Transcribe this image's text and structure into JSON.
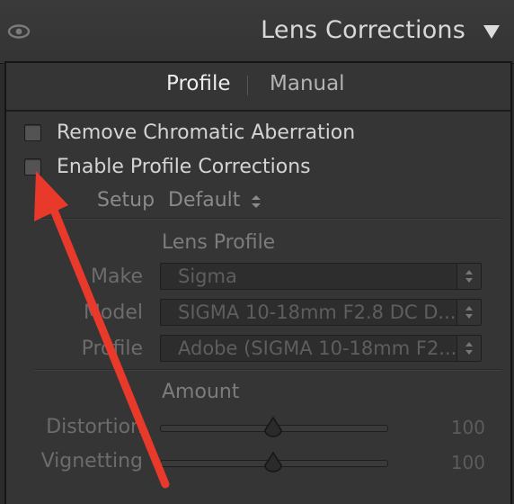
{
  "header": {
    "title": "Lens Corrections",
    "eye_icon": "eye-icon",
    "collapse_icon": "triangle-down-icon"
  },
  "tabs": {
    "profile": "Profile",
    "manual": "Manual",
    "active": "Profile"
  },
  "options": {
    "remove_ca": {
      "label": "Remove Chromatic Aberration",
      "checked": false
    },
    "enable_profile": {
      "label": "Enable Profile Corrections",
      "checked": false
    }
  },
  "setup": {
    "label": "Setup",
    "value": "Default"
  },
  "lens_profile": {
    "title": "Lens Profile",
    "make": {
      "label": "Make",
      "value": "Sigma"
    },
    "model": {
      "label": "Model",
      "value": "SIGMA 10-18mm F2.8 DC D..."
    },
    "profile": {
      "label": "Profile",
      "value": "Adobe (SIGMA 10-18mm F2..."
    }
  },
  "amount": {
    "title": "Amount",
    "distortion": {
      "label": "Distortion",
      "value": "100"
    },
    "vignetting": {
      "label": "Vignetting",
      "value": "100"
    }
  },
  "annotation": {
    "arrow_color": "#e8392b"
  }
}
